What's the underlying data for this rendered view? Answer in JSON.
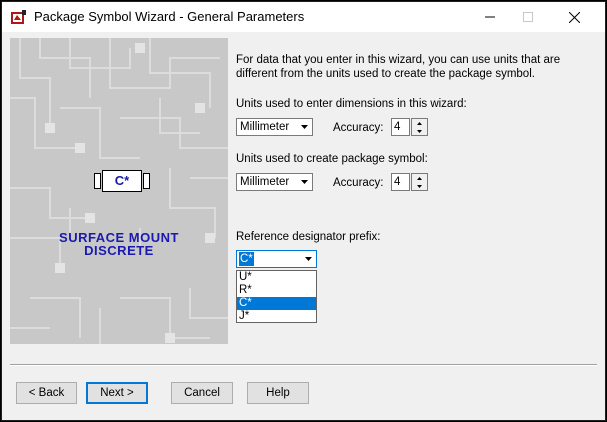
{
  "window": {
    "title": "Package Symbol Wizard - General Parameters",
    "controls": {
      "minimize_icon": "minimize-icon",
      "maximize_icon": "maximize-icon",
      "close_icon": "close-icon"
    }
  },
  "left_panel": {
    "chip_label": "C*",
    "package_line1": "SURFACE MOUNT",
    "package_line2": "DISCRETE"
  },
  "description": "For data that you enter in this wizard, you can use units that are different from the units used to create the package symbol.",
  "entry_units": {
    "label": "Units used to enter dimensions in this wizard:",
    "unit": "Millimeter",
    "accuracy_label": "Accuracy:",
    "accuracy": "4"
  },
  "symbol_units": {
    "label": "Units used to create package symbol:",
    "unit": "Millimeter",
    "accuracy_label": "Accuracy:",
    "accuracy": "4"
  },
  "ref_designator": {
    "label": "Reference designator prefix:",
    "value": "C*",
    "options": [
      "U*",
      "R*",
      "C*",
      "J*"
    ],
    "highlighted": "C*"
  },
  "buttons": {
    "back": "< Back",
    "next": "Next >",
    "cancel": "Cancel",
    "help": "Help"
  }
}
